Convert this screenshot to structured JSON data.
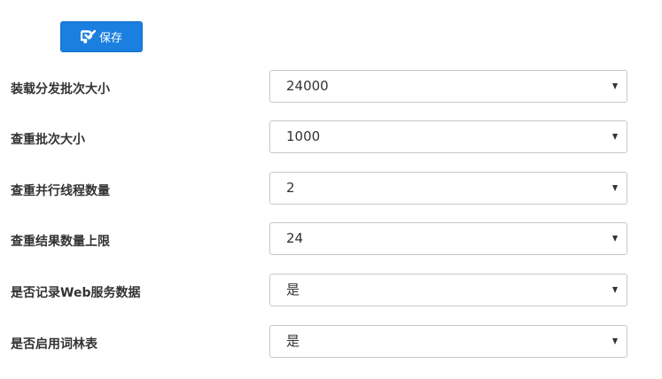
{
  "toolbar": {
    "save_label": "保存",
    "save_icon": "save-icon"
  },
  "settings": [
    {
      "label": "装载分发批次大小",
      "value": "24000"
    },
    {
      "label": "查重批次大小",
      "value": "1000"
    },
    {
      "label": "查重并行线程数量",
      "value": "2"
    },
    {
      "label": "查重结果数量上限",
      "value": "24"
    },
    {
      "label": "是否记录Web服务数据",
      "value": "是"
    },
    {
      "label": "是否启用词林表",
      "value": "是"
    }
  ],
  "colors": {
    "accent": "#1b7fe0",
    "label_text": "#333333",
    "border": "#c8c8c8"
  }
}
